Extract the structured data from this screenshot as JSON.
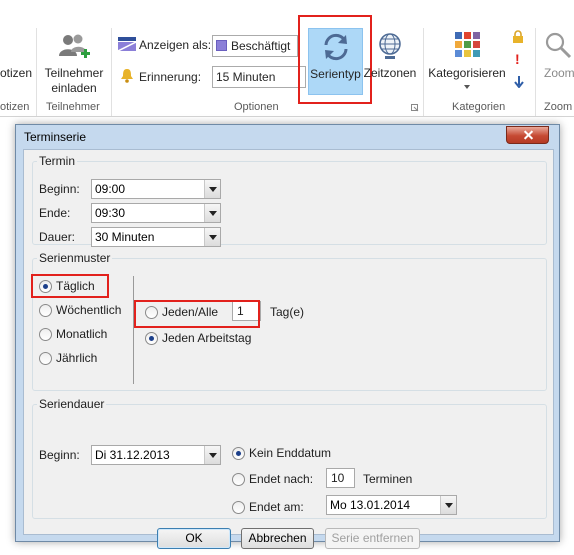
{
  "colors": {
    "highlight": "#e2211c",
    "selected_tile": "#add8f7",
    "busy_swatch": "#8b7fd8"
  },
  "ribbon": {
    "partial_left_top": "otizen",
    "partial_left_bottom": "otizen",
    "teilnehmer": {
      "line1": "Teilnehmer",
      "line2": "einladen",
      "group": "Teilnehmer",
      "icon": "people-add-icon"
    },
    "anzeigen_label": "Anzeigen als:",
    "anzeigen_value": "Beschäftigt",
    "erinnerung_label": "Erinnerung:",
    "erinnerung_value": "15 Minuten",
    "serientyp_label": "Serientyp",
    "zeitzonen_label": "Zeitzonen",
    "options_group": "Optionen",
    "kategorisieren_label": "Kategorisieren",
    "kategorien_group": "Kategorien",
    "zoom_label": "Zoom",
    "zoom_group": "Zoom"
  },
  "dialog": {
    "title": "Terminserie",
    "termin": {
      "legend": "Termin",
      "beginn_label": "Beginn:",
      "beginn_value": "09:00",
      "ende_label": "Ende:",
      "ende_value": "09:30",
      "dauer_label": "Dauer:",
      "dauer_value": "30 Minuten"
    },
    "serienmuster": {
      "legend": "Serienmuster",
      "options": [
        "Täglich",
        "Wöchentlich",
        "Monatlich",
        "Jährlich"
      ],
      "selected": "Täglich",
      "jeden_alle_label": "Jeden/Alle",
      "interval_value": "1",
      "interval_unit": "Tag(e)",
      "jeden_arbeitstag_label": "Jeden Arbeitstag"
    },
    "seriendauer": {
      "legend": "Seriendauer",
      "beginn_label": "Beginn:",
      "beginn_value": "Di 31.12.2013",
      "kein_enddatum_label": "Kein Enddatum",
      "endet_nach_label": "Endet nach:",
      "endet_nach_value": "10",
      "endet_nach_unit": "Terminen",
      "endet_am_label": "Endet am:",
      "endet_am_value": "Mo 13.01.2014"
    },
    "buttons": {
      "ok": "OK",
      "cancel": "Abbrechen",
      "remove": "Serie entfernen"
    }
  }
}
